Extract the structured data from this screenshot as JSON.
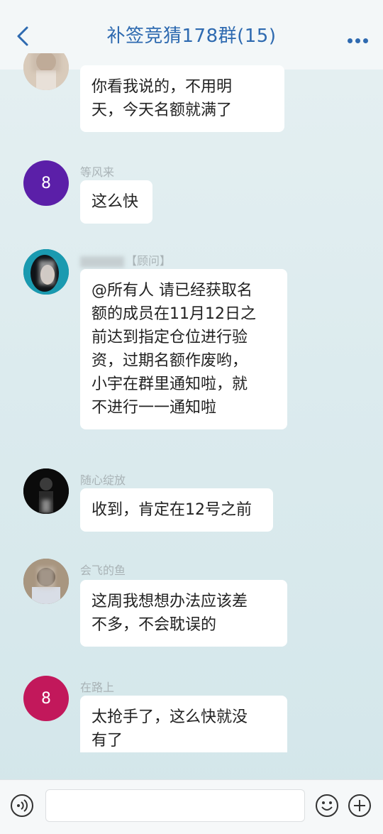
{
  "header": {
    "title": "补签竞猜178群(15)",
    "back_icon": "chevron-left-icon",
    "more_icon": "more-dots-icon",
    "accent": "#2e6ab0"
  },
  "messages": [
    {
      "sender": "",
      "avatar_text": "",
      "avatar_color": "#c9b8a8",
      "text": "你看我说的，不用明\n天，今天名额就满了"
    },
    {
      "sender": "等风来",
      "avatar_text": "8",
      "avatar_color": "#5b1fa8",
      "text": "这么快"
    },
    {
      "sender": "【顾问】",
      "avatar_text": "",
      "avatar_color": "#0f6f86",
      "text": "@所有人 请已经获取名\n额的成员在11月12日之\n前达到指定仓位进行验\n资，过期名额作废哟，\n小宇在群里通知啦，就\n不进行一一通知啦"
    },
    {
      "sender": "随心绽放",
      "avatar_text": "",
      "avatar_color": "#1a1a1a",
      "text": "收到，肯定在12号之前"
    },
    {
      "sender": "会飞的鱼",
      "avatar_text": "",
      "avatar_color": "#8b7b68",
      "text": "这周我想想办法应该差\n不多，不会耽误的"
    },
    {
      "sender": "在路上",
      "avatar_text": "8",
      "avatar_color": "#c2185b",
      "text": "太抢手了，这么快就没\n有了"
    }
  ],
  "input_bar": {
    "voice_icon": "voice-icon",
    "emoji_icon": "emoji-icon",
    "plus_icon": "plus-icon",
    "placeholder": ""
  }
}
